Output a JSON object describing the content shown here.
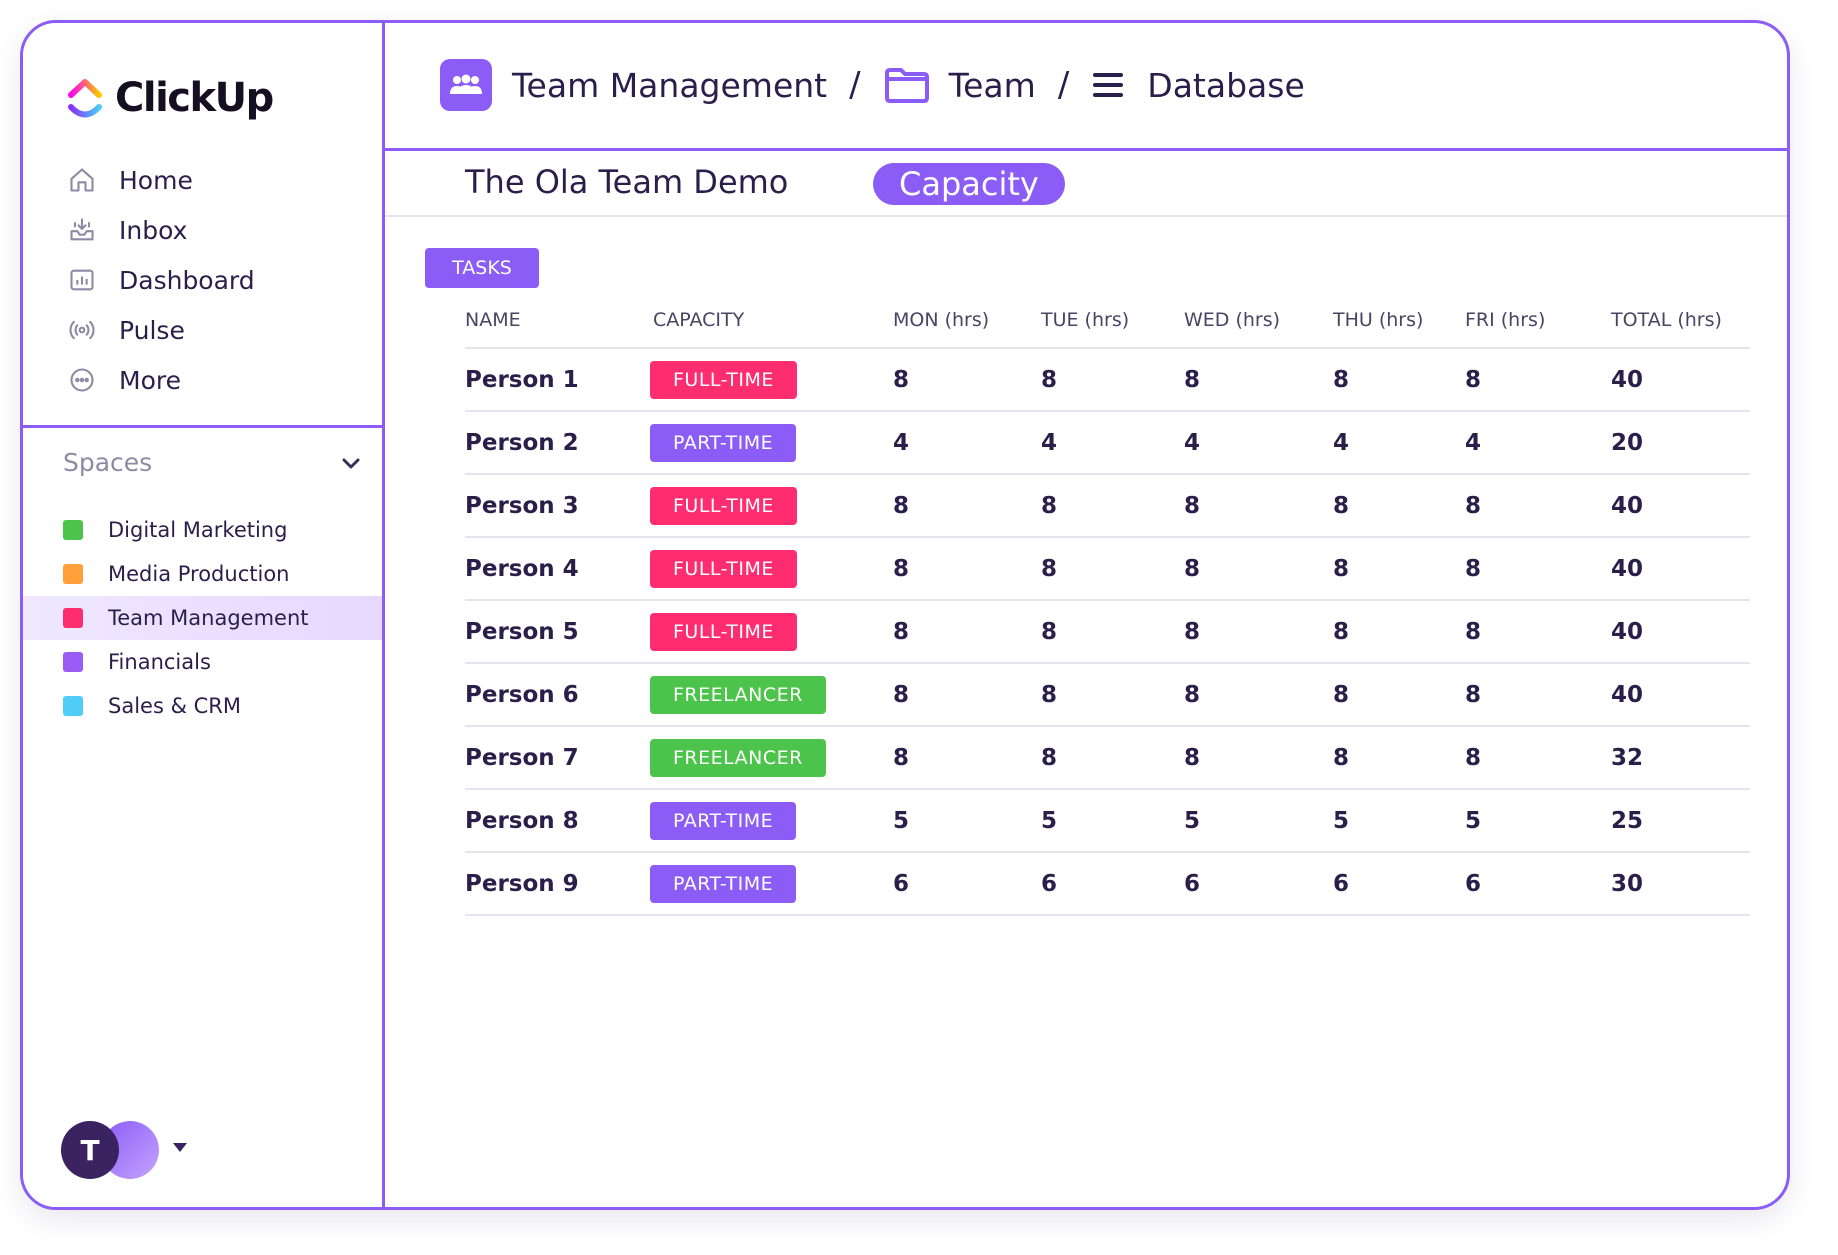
{
  "app": {
    "logo_text": "ClickUp"
  },
  "sidebar": {
    "nav": [
      {
        "label": "Home",
        "icon": "home-icon"
      },
      {
        "label": "Inbox",
        "icon": "inbox-icon"
      },
      {
        "label": "Dashboard",
        "icon": "dashboard-icon"
      },
      {
        "label": "Pulse",
        "icon": "pulse-icon"
      },
      {
        "label": "More",
        "icon": "more-icon"
      }
    ],
    "spaces_title": "Spaces",
    "spaces": [
      {
        "label": "Digital Marketing",
        "color": "#4cc34a"
      },
      {
        "label": "Media Production",
        "color": "#ff9f3a"
      },
      {
        "label": "Team Management",
        "color": "#fe2d6f",
        "active": true
      },
      {
        "label": "Financials",
        "color": "#9b5cf6"
      },
      {
        "label": "Sales & CRM",
        "color": "#4fcdf6"
      }
    ],
    "user_initial": "T"
  },
  "breadcrumb": {
    "items": [
      {
        "label": "Team Management",
        "icon": "team-icon"
      },
      {
        "label": "Team",
        "icon": "folder-icon"
      },
      {
        "label": "Database",
        "icon": "list-icon"
      }
    ],
    "separator": "/"
  },
  "view": {
    "title": "The Ola Team Demo",
    "active_view": "Capacity"
  },
  "table": {
    "group_label": "TASKS",
    "columns": [
      "NAME",
      "CAPACITY",
      "MON (hrs)",
      "TUE (hrs)",
      "WED (hrs)",
      "THU (hrs)",
      "FRI (hrs)",
      "TOTAL (hrs)"
    ],
    "rows": [
      {
        "name": "Person 1",
        "capacity": "FULL-TIME",
        "mon": "8",
        "tue": "8",
        "wed": "8",
        "thu": "8",
        "fri": "8",
        "total": "40"
      },
      {
        "name": "Person 2",
        "capacity": "PART-TIME",
        "mon": "4",
        "tue": "4",
        "wed": "4",
        "thu": "4",
        "fri": "4",
        "total": "20"
      },
      {
        "name": "Person 3",
        "capacity": "FULL-TIME",
        "mon": "8",
        "tue": "8",
        "wed": "8",
        "thu": "8",
        "fri": "8",
        "total": "40"
      },
      {
        "name": "Person 4",
        "capacity": "FULL-TIME",
        "mon": "8",
        "tue": "8",
        "wed": "8",
        "thu": "8",
        "fri": "8",
        "total": "40"
      },
      {
        "name": "Person 5",
        "capacity": "FULL-TIME",
        "mon": "8",
        "tue": "8",
        "wed": "8",
        "thu": "8",
        "fri": "8",
        "total": "40"
      },
      {
        "name": "Person 6",
        "capacity": "FREELANCER",
        "mon": "8",
        "tue": "8",
        "wed": "8",
        "thu": "8",
        "fri": "8",
        "total": "40"
      },
      {
        "name": "Person 7",
        "capacity": "FREELANCER",
        "mon": "8",
        "tue": "8",
        "wed": "8",
        "thu": "8",
        "fri": "8",
        "total": "32"
      },
      {
        "name": "Person 8",
        "capacity": "PART-TIME",
        "mon": "5",
        "tue": "5",
        "wed": "5",
        "thu": "5",
        "fri": "5",
        "total": "25"
      },
      {
        "name": "Person 9",
        "capacity": "PART-TIME",
        "mon": "6",
        "tue": "6",
        "wed": "6",
        "thu": "6",
        "fri": "6",
        "total": "30"
      }
    ],
    "badge_colors": {
      "FULL-TIME": "#fe2d6f",
      "PART-TIME": "#8b5cf6",
      "FREELANCER": "#4cc34a"
    }
  },
  "colors": {
    "accent": "#8b5cf6",
    "text": "#2a1f4a"
  }
}
